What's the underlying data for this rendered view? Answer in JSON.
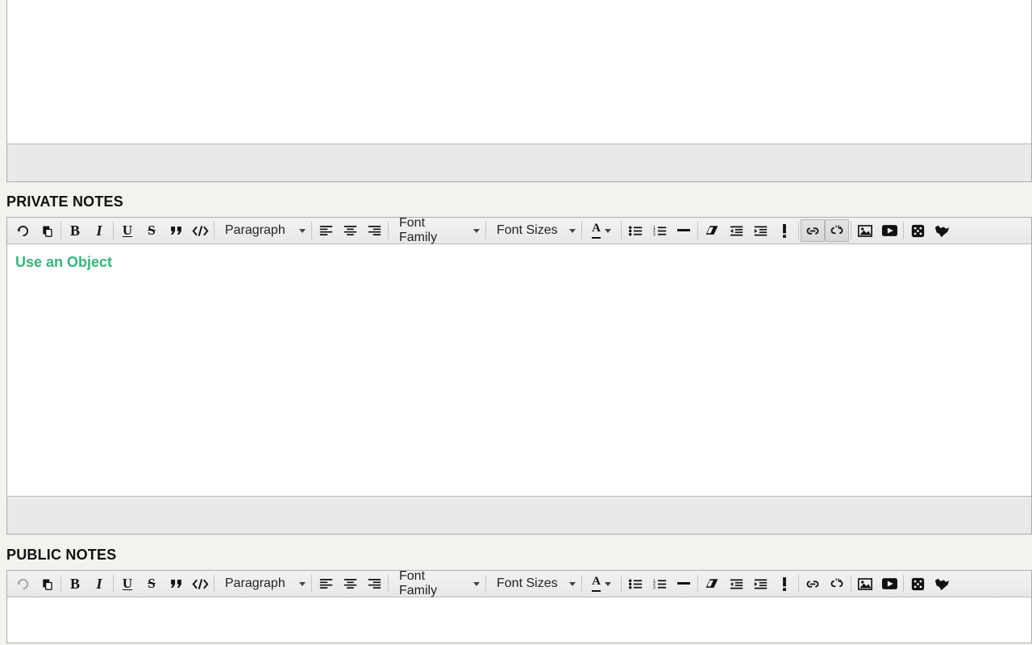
{
  "sections": {
    "private_label": "PRIVATE NOTES",
    "public_label": "PUBLIC NOTES"
  },
  "dropdowns": {
    "paragraph": "Paragraph",
    "font_family": "Font Family",
    "font_sizes": "Font Sizes"
  },
  "private_editor": {
    "content_link_text": "Use an Object",
    "undo_enabled": true
  },
  "public_editor": {
    "undo_enabled": false
  },
  "icons": {
    "undo": "undo-icon",
    "paste": "paste-icon",
    "bold": "B",
    "italic": "I",
    "underline": "U",
    "strike": "S",
    "quote": "quote-icon",
    "code": "code-icon",
    "align_left": "align-left-icon",
    "align_center": "align-center-icon",
    "align_right": "align-right-icon",
    "bullet": "bullet-list-icon",
    "number": "number-list-icon",
    "hr": "hr-icon",
    "eraser": "eraser-icon",
    "outdent": "outdent-icon",
    "indent": "indent-icon",
    "important": "important-icon",
    "link": "link-icon",
    "unlink": "unlink-icon",
    "image": "image-icon",
    "video": "video-icon",
    "dice": "dice-icon",
    "wolf": "wolf-icon"
  }
}
